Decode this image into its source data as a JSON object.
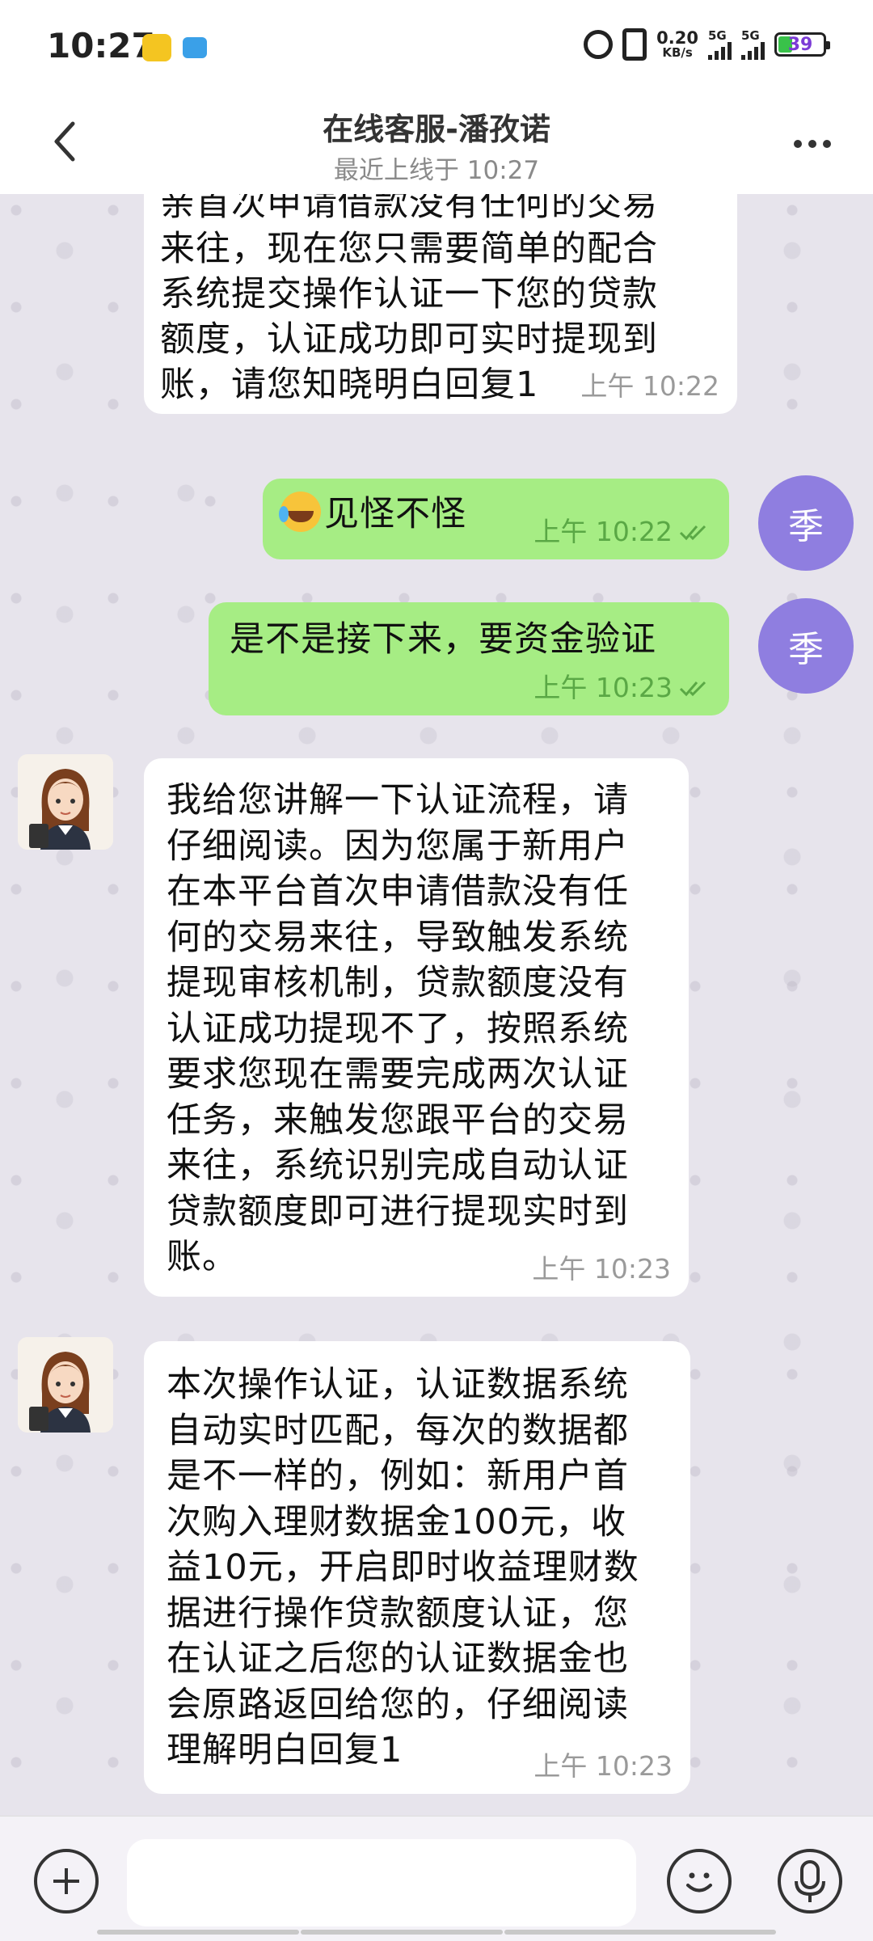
{
  "status_bar": {
    "time": "10:27",
    "net_speed_value": "0.20",
    "net_speed_unit": "KB/s",
    "sim1_label": "5G",
    "sim2_label": "5G",
    "battery": "39",
    "icons": [
      "notification-app-icon",
      "notification-app-icon-2",
      "alarm-icon",
      "vibrate-icon",
      "signal-icon",
      "battery-icon"
    ]
  },
  "header": {
    "title": "在线客服-潘孜诺",
    "subtitle": "最近上线于 10:27"
  },
  "messages": [
    {
      "sender": "agent",
      "text": "亲首次申请借款没有任何的交易\n来往，现在您只需要简单的配合\n系统提交操作认证一下您的贷款\n额度，认证成功即可实时提现到\n账，请您知晓明白回复1",
      "time": "上午  10:22"
    },
    {
      "sender": "user",
      "avatar": "季",
      "text": "见怪不怪",
      "time": "上午  10:22"
    },
    {
      "sender": "user",
      "avatar": "季",
      "text": "是不是接下来，要资金验证",
      "time": "上午  10:23"
    },
    {
      "sender": "agent",
      "text": "我给您讲解一下认证流程，请\n仔细阅读。因为您属于新用户\n在本平台首次申请借款没有任\n何的交易来往，导致触发系统\n提现审核机制，贷款额度没有\n认证成功提现不了，按照系统\n要求您现在需要完成两次认证\n任务，来触发您跟平台的交易\n来往，系统识别完成自动认证\n贷款额度即可进行提现实时到\n账。",
      "time": "上午  10:23"
    },
    {
      "sender": "agent",
      "text": "本次操作认证，认证数据系统\n自动实时匹配，每次的数据都\n是不一样的，例如：新用户首\n次购入理财数据金100元，收\n益10元，开启即时收益理财数\n据进行操作贷款额度认证，您\n在认证之后您的认证数据金也\n会原路返回给您的，仔细阅读\n理解明白回复1",
      "time": "上午  10:23"
    }
  ],
  "input_bar": {
    "placeholder": ""
  },
  "colors": {
    "outgoing_bubble": "#a6ed84",
    "incoming_bubble": "#ffffff",
    "user_avatar": "#8f7ee0",
    "chat_background": "#e7e4ec"
  }
}
